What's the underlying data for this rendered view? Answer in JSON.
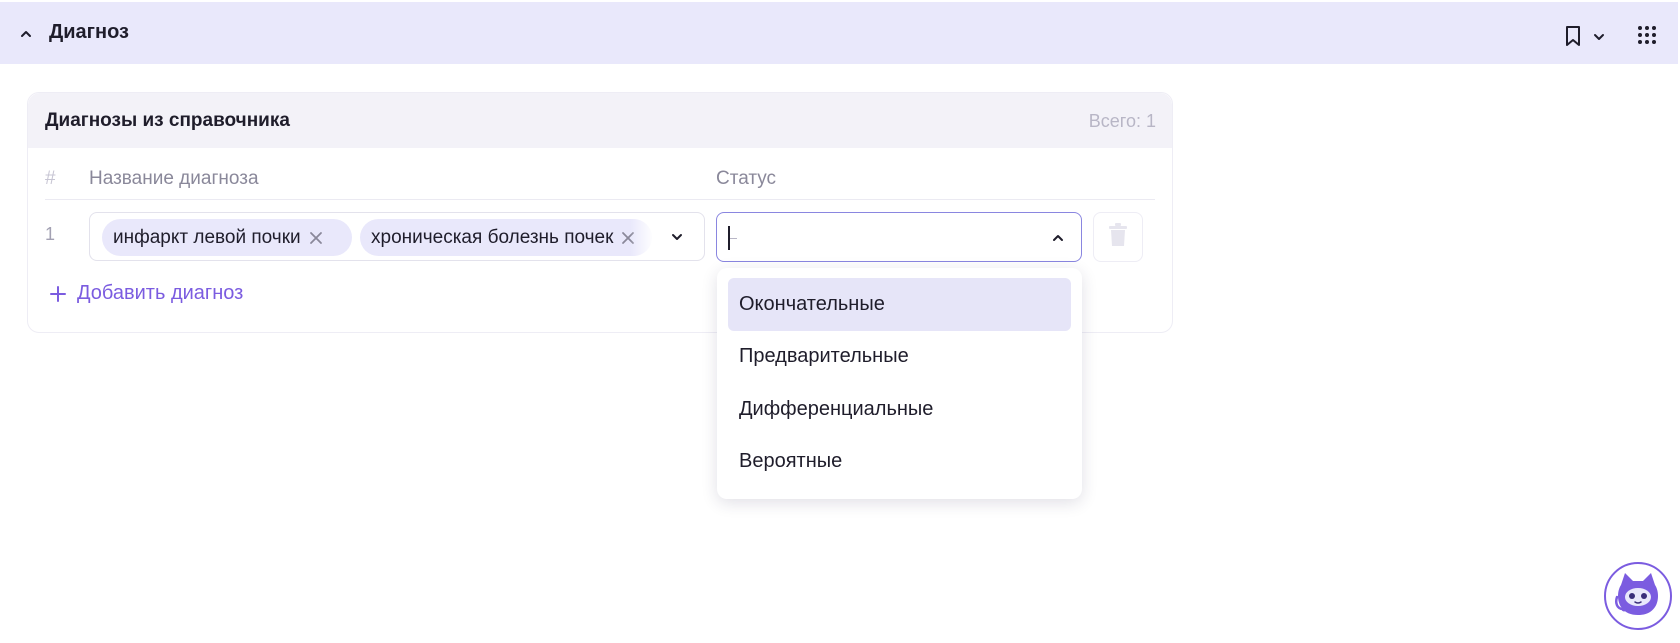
{
  "header": {
    "title": "Диагноз"
  },
  "card": {
    "title": "Диагнозы из справочника",
    "total": "Всего: 1",
    "columns": {
      "num": "#",
      "name": "Название диагноза",
      "status": "Статус"
    },
    "row": {
      "number": "1",
      "tags": [
        "инфаркт левой почки",
        "хроническая болезнь почек"
      ]
    },
    "add_label": "Добавить диагноз"
  },
  "status_menu": {
    "options": [
      "Окончательные",
      "Предварительные",
      "Дифференциальные",
      "Вероятные"
    ],
    "highlighted_index": 0
  },
  "colors": {
    "accent": "#7b5ce0",
    "header_bg": "#e9e8fb",
    "tag_bg": "#e9e8fb"
  }
}
